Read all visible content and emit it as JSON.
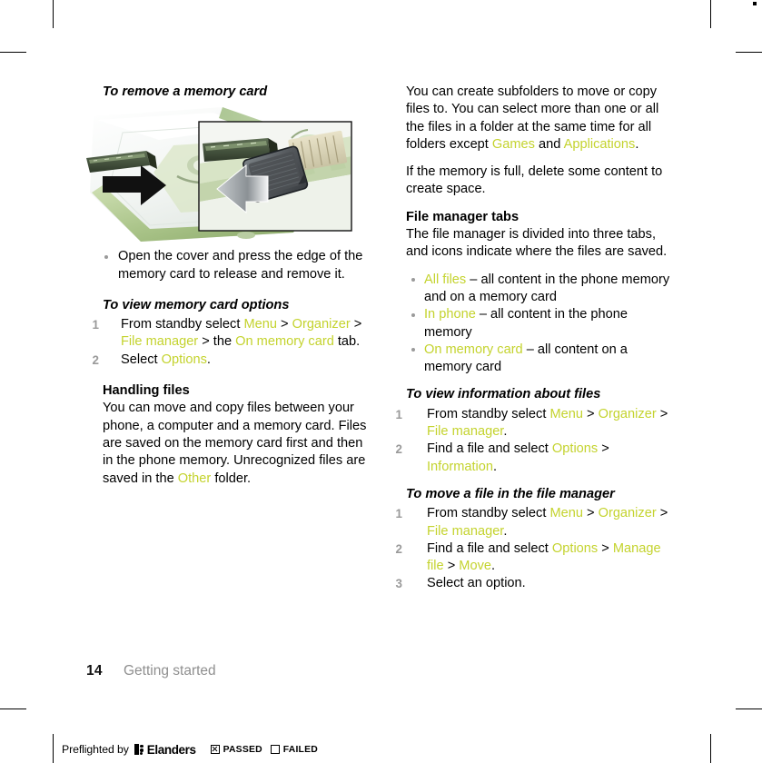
{
  "accent_color": "#c4d32e",
  "muted_color": "#9a9a9a",
  "figure": {
    "caption_title": "To remove a memory card",
    "alt": "Illustration of a phone with its cover opened showing a memory card being pressed and removed, with an inset close-up and a black arrow"
  },
  "left_column": {
    "heading": "To remove a memory card",
    "bullets": [
      "Open the cover and press the edge of the memory card to release and remove it."
    ],
    "task_1": {
      "title": "To view memory card options",
      "steps": [
        {
          "number": "1",
          "parts": [
            {
              "text": "From standby select ",
              "accent": false
            },
            {
              "text": "Menu",
              "accent": true
            },
            {
              "text": " > ",
              "accent": false
            },
            {
              "text": "Organizer",
              "accent": true
            },
            {
              "text": " > ",
              "accent": false
            },
            {
              "text": "File manager",
              "accent": true
            },
            {
              "text": " > the ",
              "accent": false
            },
            {
              "text": "On memory card",
              "accent": true
            },
            {
              "text": " tab.",
              "accent": false
            }
          ]
        },
        {
          "number": "2",
          "parts": [
            {
              "text": "Select ",
              "accent": false
            },
            {
              "text": "Options",
              "accent": true
            },
            {
              "text": ".",
              "accent": false
            }
          ]
        }
      ]
    },
    "section_handling": {
      "heading": "Handling files",
      "parts": [
        {
          "text": "You can move and copy files between your phone, a computer and a memory card. Files are saved on the memory card first and then in the phone memory. Unrecognized files are saved in the ",
          "accent": false
        },
        {
          "text": "Other",
          "accent": true
        },
        {
          "text": " folder.",
          "accent": false
        }
      ]
    }
  },
  "right_column": {
    "paragraph_1": [
      {
        "text": "You can create subfolders to move or copy files to. You can select more than one or all the files in a folder at the same time for all folders except ",
        "accent": false
      },
      {
        "text": "Games",
        "accent": true
      },
      {
        "text": " and ",
        "accent": false
      },
      {
        "text": "Applications",
        "accent": true
      },
      {
        "text": ".",
        "accent": false
      }
    ],
    "paragraph_2": [
      {
        "text": "If the memory is full, delete some content to create space.",
        "accent": false
      }
    ],
    "section_tabs": {
      "heading": "File manager tabs",
      "intro": "The file manager is divided into three tabs, and icons indicate where the files are saved.",
      "items": [
        [
          {
            "text": "All files",
            "accent": true
          },
          {
            "text": " – all content in the phone memory and on a memory card",
            "accent": false
          }
        ],
        [
          {
            "text": "In phone",
            "accent": true
          },
          {
            "text": " – all content in the phone memory",
            "accent": false
          }
        ],
        [
          {
            "text": "On memory card",
            "accent": true
          },
          {
            "text": " – all content on a memory card",
            "accent": false
          }
        ]
      ]
    },
    "task_2": {
      "title": "To view information about files",
      "steps": [
        {
          "number": "1",
          "parts": [
            {
              "text": "From standby select ",
              "accent": false
            },
            {
              "text": "Menu",
              "accent": true
            },
            {
              "text": " > ",
              "accent": false
            },
            {
              "text": "Organizer",
              "accent": true
            },
            {
              "text": " > ",
              "accent": false
            },
            {
              "text": "File manager",
              "accent": true
            },
            {
              "text": ".",
              "accent": false
            }
          ]
        },
        {
          "number": "2",
          "parts": [
            {
              "text": "Find a file and select ",
              "accent": false
            },
            {
              "text": "Options",
              "accent": true
            },
            {
              "text": " > ",
              "accent": false
            },
            {
              "text": "Information",
              "accent": true
            },
            {
              "text": ".",
              "accent": false
            }
          ]
        }
      ]
    },
    "task_3": {
      "title": "To move a file in the file manager",
      "steps": [
        {
          "number": "1",
          "parts": [
            {
              "text": "From standby select ",
              "accent": false
            },
            {
              "text": "Menu",
              "accent": true
            },
            {
              "text": " > ",
              "accent": false
            },
            {
              "text": "Organizer",
              "accent": true
            },
            {
              "text": " > ",
              "accent": false
            },
            {
              "text": "File manager",
              "accent": true
            },
            {
              "text": ".",
              "accent": false
            }
          ]
        },
        {
          "number": "2",
          "parts": [
            {
              "text": "Find a file and select ",
              "accent": false
            },
            {
              "text": "Options",
              "accent": true
            },
            {
              "text": " > ",
              "accent": false
            },
            {
              "text": "Manage file",
              "accent": true
            },
            {
              "text": " > ",
              "accent": false
            },
            {
              "text": "Move",
              "accent": true
            },
            {
              "text": ".",
              "accent": false
            }
          ]
        },
        {
          "number": "3",
          "parts": [
            {
              "text": "Select an option.",
              "accent": false
            }
          ]
        }
      ]
    }
  },
  "footer": {
    "page_number": "14",
    "chapter": "Getting started"
  },
  "preflight": {
    "label": "Preflighted by",
    "brand": "Elanders",
    "passed_label": "PASSED",
    "failed_label": "FAILED",
    "passed_checked": true,
    "failed_checked": false
  }
}
